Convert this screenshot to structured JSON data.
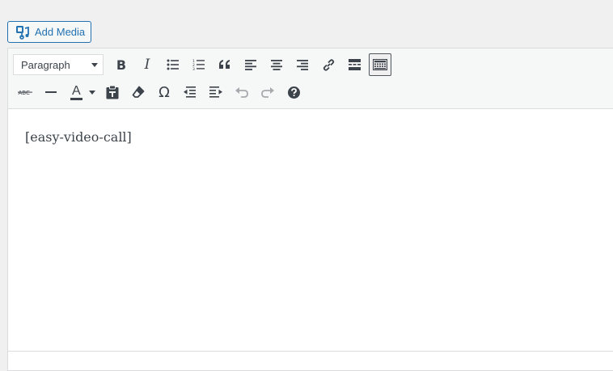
{
  "add_media": {
    "label": "Add Media",
    "icon": "media-icon"
  },
  "toolbar": {
    "format_select": {
      "selected": "Paragraph"
    },
    "row1": [
      {
        "name": "bold-button",
        "icon": "bold-icon",
        "glyph": "B"
      },
      {
        "name": "italic-button",
        "icon": "italic-icon",
        "glyph": "I"
      },
      {
        "name": "bulleted-list-button",
        "icon": "bulleted-list-icon"
      },
      {
        "name": "numbered-list-button",
        "icon": "numbered-list-icon"
      },
      {
        "name": "blockquote-button",
        "icon": "quote-icon",
        "glyph": "❝"
      },
      {
        "name": "align-left-button",
        "icon": "align-left-icon"
      },
      {
        "name": "align-center-button",
        "icon": "align-center-icon"
      },
      {
        "name": "align-right-button",
        "icon": "align-right-icon"
      },
      {
        "name": "insert-link-button",
        "icon": "link-icon"
      },
      {
        "name": "read-more-button",
        "icon": "read-more-icon"
      },
      {
        "name": "toolbar-toggle-button",
        "icon": "keyboard-icon",
        "active": true
      }
    ],
    "row2": [
      {
        "name": "strikethrough-button",
        "icon": "strikethrough-icon",
        "glyph": "ABC"
      },
      {
        "name": "horizontal-line-button",
        "icon": "horizontal-line-icon"
      },
      {
        "name": "text-color-button",
        "icon": "text-color-icon",
        "glyph": "A"
      },
      {
        "name": "paste-as-text-button",
        "icon": "paste-text-icon"
      },
      {
        "name": "clear-formatting-button",
        "icon": "eraser-icon"
      },
      {
        "name": "special-character-button",
        "icon": "omega-icon",
        "glyph": "Ω"
      },
      {
        "name": "decrease-indent-button",
        "icon": "outdent-icon"
      },
      {
        "name": "increase-indent-button",
        "icon": "indent-icon"
      },
      {
        "name": "undo-button",
        "icon": "undo-icon",
        "disabled": true
      },
      {
        "name": "redo-button",
        "icon": "redo-icon",
        "disabled": true
      },
      {
        "name": "keyboard-shortcuts-button",
        "icon": "help-icon"
      }
    ]
  },
  "content": {
    "text": "[easy-video-call]"
  },
  "colors": {
    "accent": "#2271b1",
    "icon": "#3c434a",
    "border": "#dcdcde",
    "toolbar_bg": "#f6f7f7",
    "page_bg": "#f0f0f1"
  }
}
